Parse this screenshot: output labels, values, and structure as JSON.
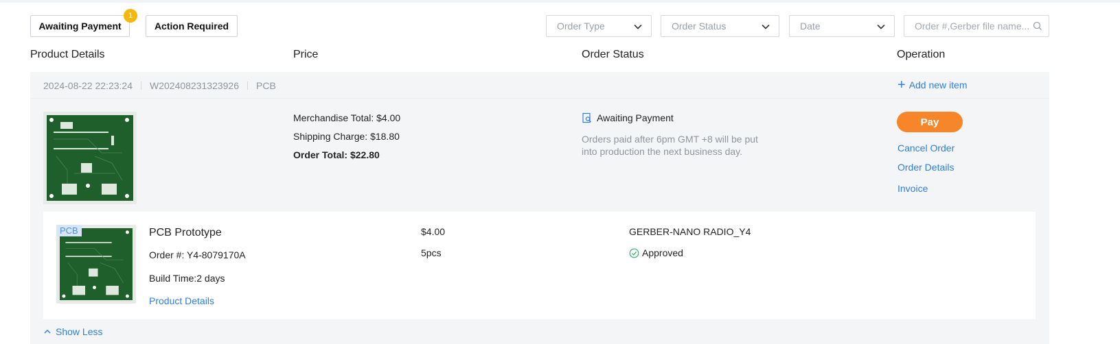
{
  "filters": {
    "awaiting_payment": {
      "label": "Awaiting Payment",
      "badge": "1"
    },
    "action_required": {
      "label": "Action Required"
    },
    "order_type": "Order Type",
    "order_status": "Order Status",
    "date": "Date",
    "search_placeholder": "Order #,Gerber file name..."
  },
  "columns": {
    "product": "Product Details",
    "price": "Price",
    "status": "Order Status",
    "operation": "Operation"
  },
  "order": {
    "datetime": "2024-08-22 22:23:24",
    "order_no": "W202408231323926",
    "category": "PCB",
    "add_item": "Add new item",
    "merchandise_total": "Merchandise Total: $4.00",
    "shipping_charge": "Shipping Charge: $18.80",
    "order_total": "Order Total: $22.80",
    "status": "Awaiting Payment",
    "status_note": "Orders paid after 6pm GMT +8 will be put into production the next business day.",
    "actions": {
      "pay": "Pay",
      "cancel": "Cancel Order",
      "details": "Order Details",
      "invoice": "Invoice"
    },
    "items": [
      {
        "tag": "PCB",
        "title": "PCB Prototype",
        "order_no": "Order #: Y4-8079170A",
        "build_time": "Build Time:2 days",
        "details_link": "Product Details",
        "price": "$4.00",
        "qty": "5pcs",
        "file": "GERBER-NANO RADIO_Y4",
        "review_status": "Approved"
      }
    ],
    "show_less": "Show Less"
  },
  "colors": {
    "accent": "#2f7ed8",
    "pay": "#f7862a",
    "badge": "#f5b80a",
    "approved": "#2fb36a",
    "pcb": "#1f5f2c"
  }
}
